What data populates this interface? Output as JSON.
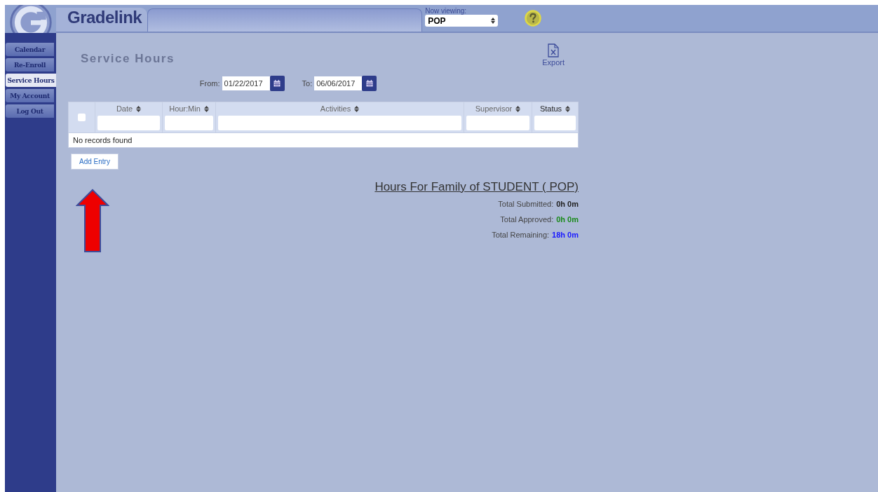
{
  "brand": "Gradelink",
  "viewing": {
    "label": "Now viewing:",
    "value": "POP"
  },
  "nav": [
    {
      "label": "Calendar",
      "selected": false
    },
    {
      "label": "Re-Enroll",
      "selected": false
    },
    {
      "label": "Service Hours",
      "selected": true
    },
    {
      "label": "My Account",
      "selected": false
    },
    {
      "label": "Log Out",
      "selected": false
    }
  ],
  "page_title": "Service Hours",
  "export": {
    "label": "Export"
  },
  "range": {
    "from_label": "From:",
    "from": "01/22/2017",
    "to_label": "To:",
    "to": "06/06/2017"
  },
  "table": {
    "columns": [
      {
        "label": "Date",
        "sorted": false
      },
      {
        "label": "Hour:Min",
        "sorted": false
      },
      {
        "label": "Activities",
        "sorted": false
      },
      {
        "label": "Supervisor",
        "sorted": false
      },
      {
        "label": "Status",
        "sorted": true
      }
    ],
    "select_all": {
      "checked": false
    },
    "empty_message": "No records found"
  },
  "add_button": "Add Entry",
  "summary": {
    "title": "Hours For Family of STUDENT ( POP)",
    "totals": [
      {
        "label": "Total Submitted:",
        "value": "0h 0m",
        "color": "#222222"
      },
      {
        "label": "Total Approved:",
        "value": "0h 0m",
        "color": "#1a8a1a"
      },
      {
        "label": "Total Remaining:",
        "value": "18h 0m",
        "color": "#1a1aff"
      }
    ]
  }
}
